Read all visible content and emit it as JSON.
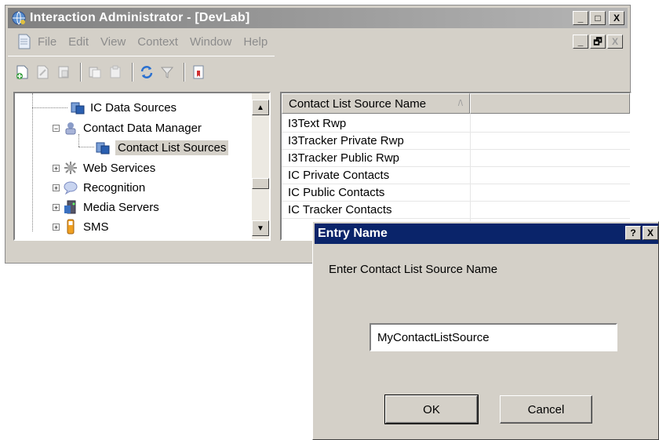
{
  "window": {
    "title": "Interaction Administrator - [DevLab]",
    "controls": {
      "minimize": "_",
      "maximize": "□",
      "close": "X"
    }
  },
  "menubar": {
    "items": [
      {
        "label": "File"
      },
      {
        "label": "Edit"
      },
      {
        "label": "View"
      },
      {
        "label": "Context"
      },
      {
        "label": "Window"
      },
      {
        "label": "Help"
      }
    ],
    "mdi_controls": {
      "minimize": "_",
      "restore": "🗗",
      "close": "X"
    }
  },
  "toolbar": {
    "icons": [
      "new-icon",
      "edit-icon",
      "cut-icon",
      "copy-icon",
      "paste-icon",
      "refresh-icon",
      "filter-icon",
      "bookmark-icon"
    ]
  },
  "tree": {
    "items": [
      {
        "label": "IC Data Sources",
        "icon": "data-sources-icon"
      },
      {
        "label": "Contact Data Manager",
        "icon": "contact-data-manager-icon",
        "expander": "−"
      },
      {
        "label": "Contact List Sources",
        "icon": "contact-list-sources-icon"
      },
      {
        "label": "Web Services",
        "icon": "web-services-icon",
        "expander": "+"
      },
      {
        "label": "Recognition",
        "icon": "recognition-icon",
        "expander": "+"
      },
      {
        "label": "Media Servers",
        "icon": "media-servers-icon",
        "expander": "+"
      },
      {
        "label": "SMS",
        "icon": "sms-icon",
        "expander": "+"
      }
    ],
    "scroll_up": "▲",
    "scroll_down": "▼"
  },
  "list": {
    "column_header": "Contact List Source Name",
    "sort_indicator": "/\\",
    "rows": [
      "I3Text Rwp",
      "I3Tracker Private Rwp",
      "I3Tracker Public Rwp",
      "IC Private Contacts",
      "IC Public Contacts",
      "IC Tracker Contacts"
    ]
  },
  "dialog": {
    "title": "Entry Name",
    "help": "?",
    "close": "X",
    "prompt": "Enter Contact List Source Name",
    "input_value": "MyContactListSource",
    "ok_label": "OK",
    "cancel_label": "Cancel"
  },
  "colors": {
    "inactive_title": "#808080",
    "active_title": "#0a246a",
    "face": "#d4d0c8"
  }
}
